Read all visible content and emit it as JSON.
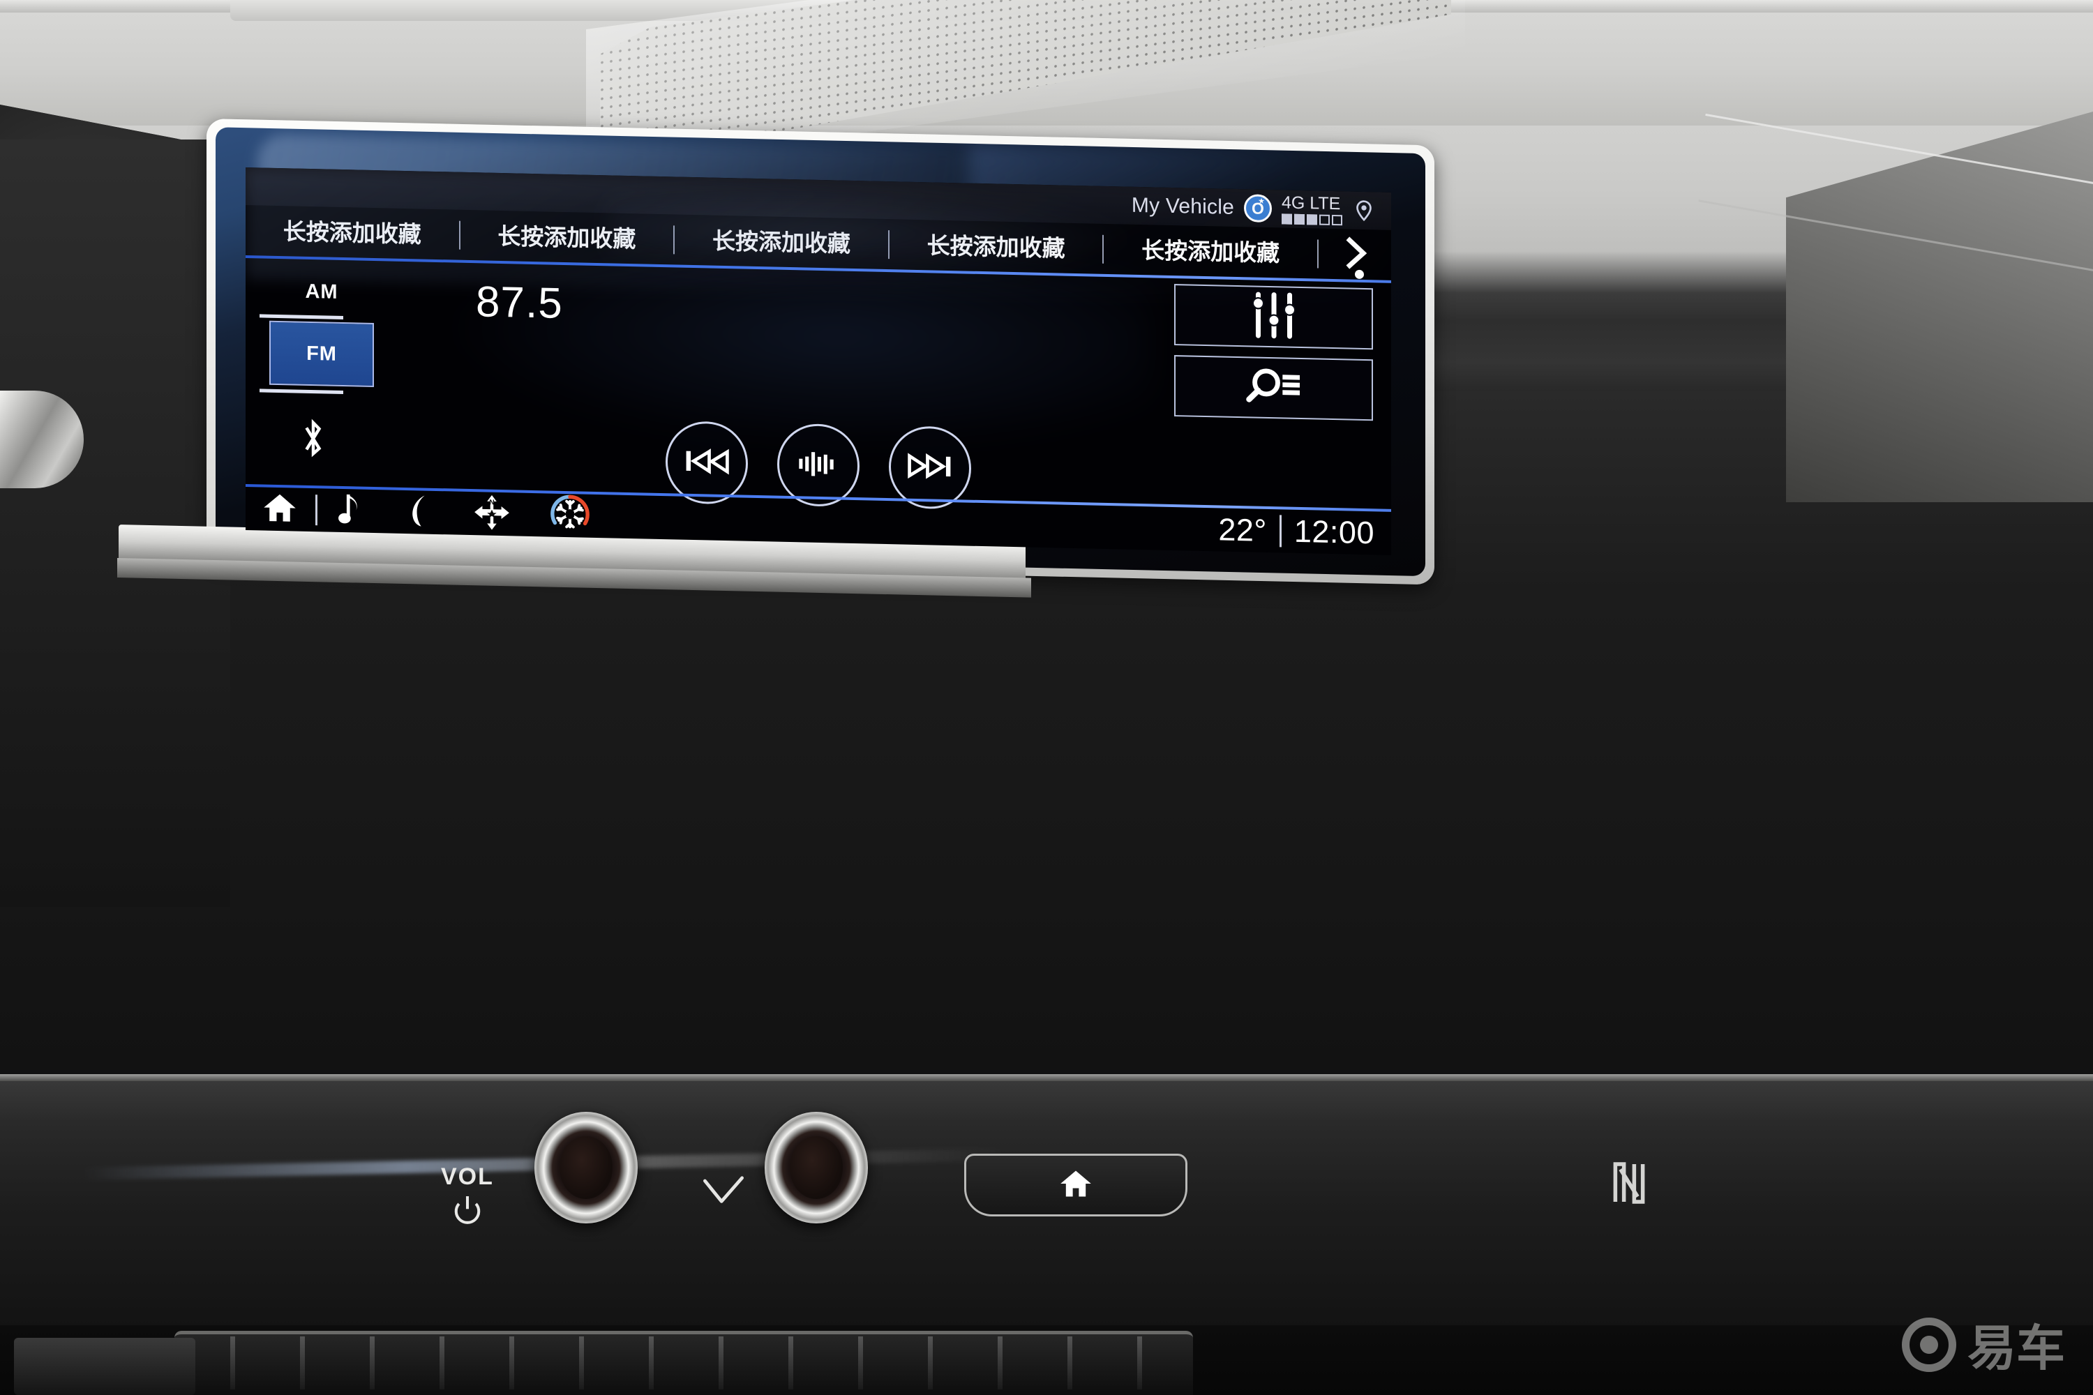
{
  "status_bar": {
    "vehicle_label": "My Vehicle",
    "onstar_icon": "onstar-logo",
    "onstar_letter": "O",
    "onstar_star": "★",
    "network_label": "4G LTE",
    "signal_bars_total": 5,
    "signal_bars_filled": 3,
    "location_icon": "location-pin-icon"
  },
  "favorites_bar": {
    "items": [
      {
        "label": "长按添加收藏"
      },
      {
        "label": "长按添加收藏"
      },
      {
        "label": "长按添加收藏"
      },
      {
        "label": "长按添加收藏"
      },
      {
        "label": "长按添加收藏"
      }
    ],
    "next_icon": "chevron-right-icon",
    "page_indicator_icon": "page-dot-indicator"
  },
  "radio": {
    "band_am_label": "AM",
    "band_fm_label": "FM",
    "selected_band": "FM",
    "frequency": "87.5",
    "bluetooth_icon": "bluetooth-icon",
    "equalizer_icon": "equalizer-sliders-icon",
    "browse_icon": "search-list-icon",
    "transport": {
      "previous_icon": "skip-previous-icon",
      "tune_icon": "tune-waveform-icon",
      "next_icon": "skip-next-icon"
    }
  },
  "nav_bar": {
    "items": [
      {
        "icon": "home-icon"
      },
      {
        "icon": "music-note-icon"
      },
      {
        "icon": "phone-icon"
      },
      {
        "icon": "navigation-compass-icon"
      },
      {
        "icon": "climate-snowflake-icon"
      }
    ],
    "temperature": "22°",
    "clock": "12:00"
  },
  "hardware": {
    "vol_label": "VOL",
    "power_icon": "power-icon",
    "volume_knob": "volume-knob",
    "tune_knob": "tune-knob",
    "check_icon": "check-mark-icon",
    "home_button_icon": "home-button-icon",
    "nfc_icon": "nfc-icon"
  },
  "watermark": {
    "logo_icon": "yiche-logo-icon",
    "text": "易车"
  },
  "colors": {
    "accent_blue": "#3d73f0",
    "fm_selected_bg": "#29559f",
    "onstar_blue": "#3b7fd4",
    "screen_black": "#010104",
    "climate_cold": "#7fb7e8",
    "climate_hot": "#e8492a"
  }
}
